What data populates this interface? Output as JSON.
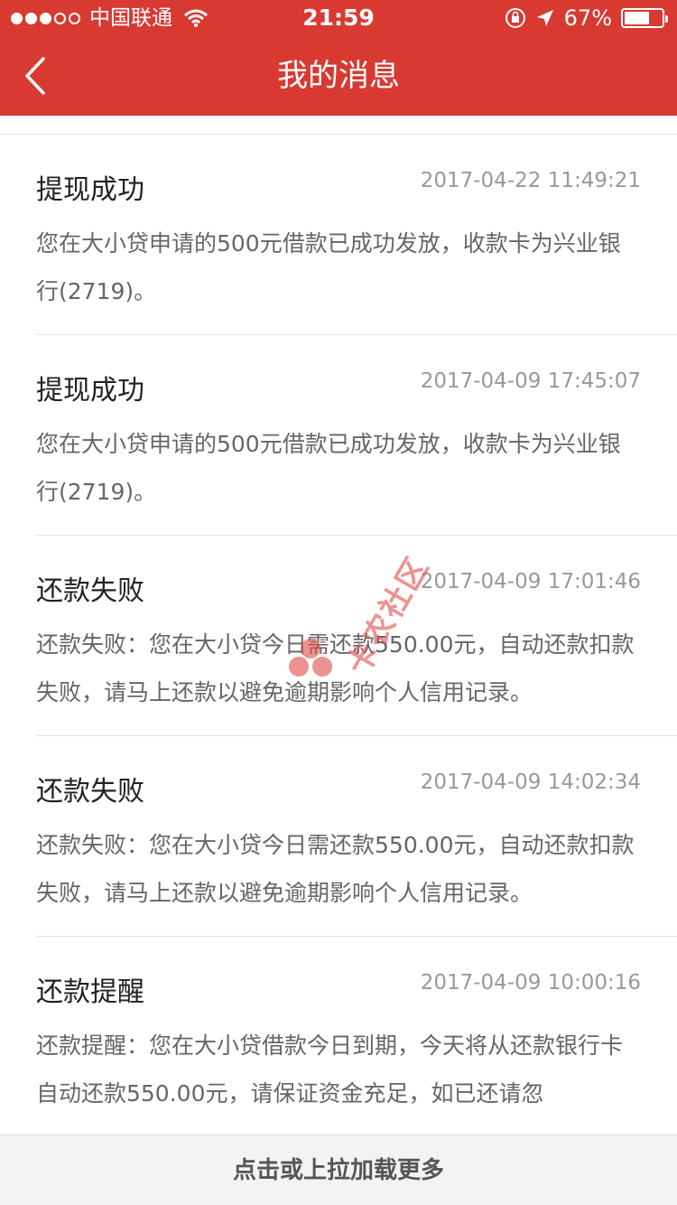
{
  "status_bar": {
    "carrier": "中国联通",
    "time": "21:59",
    "battery": "67%",
    "battery_level": 0.67
  },
  "nav": {
    "title": "我的消息"
  },
  "messages": [
    {
      "title": "提现成功",
      "time": "2017-04-22 11:49:21",
      "body": "您在大小贷申请的500元借款已成功发放，收款卡为兴业银行(2719)。"
    },
    {
      "title": "提现成功",
      "time": "2017-04-09 17:45:07",
      "body": "您在大小贷申请的500元借款已成功发放，收款卡为兴业银行(2719)。"
    },
    {
      "title": "还款失败",
      "time": "2017-04-09 17:01:46",
      "body": "还款失败：您在大小贷今日需还款550.00元，自动还款扣款失败，请马上还款以避免逾期影响个人信用记录。"
    },
    {
      "title": "还款失败",
      "time": "2017-04-09 14:02:34",
      "body": "还款失败：您在大小贷今日需还款550.00元，自动还款扣款失败，请马上还款以避免逾期影响个人信用记录。"
    },
    {
      "title": "还款提醒",
      "time": "2017-04-09 10:00:16",
      "body": "还款提醒：您在大小贷借款今日到期，今天将从还款银行卡自动还款550.00元，请保证资金充足，如已还请忽"
    }
  ],
  "watermark": {
    "text": "卡农社区"
  },
  "footer": {
    "load_more": "点击或上拉加载更多"
  },
  "colors": {
    "header_bg": "#d83a32",
    "watermark": "#e04b4b"
  }
}
